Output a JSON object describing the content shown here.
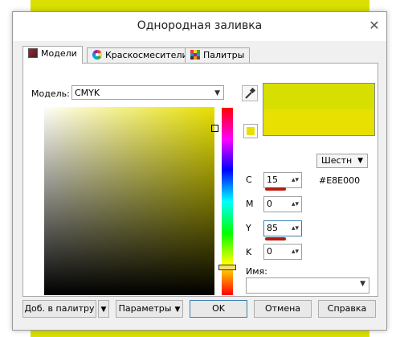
{
  "window": {
    "title": "Однородная заливка",
    "close_glyph": "✕"
  },
  "tabs": [
    {
      "label": "Модели",
      "icon": "models-icon"
    },
    {
      "label": "Краскосмесители",
      "icon": "color-wheel-icon"
    },
    {
      "label": "Палитры",
      "icon": "palette-grid-icon"
    }
  ],
  "model": {
    "label": "Модель:",
    "value": "CMYK"
  },
  "format": {
    "value": "Шестн"
  },
  "hex_value": "#E8E000",
  "channels": [
    {
      "label": "C",
      "value": "15"
    },
    {
      "label": "M",
      "value": "0"
    },
    {
      "label": "Y",
      "value": "85"
    },
    {
      "label": "K",
      "value": "0"
    }
  ],
  "name_label": "Имя:",
  "buttons": {
    "add_to_palette": "Доб. в палитру",
    "params": "Параметры",
    "ok": "OK",
    "cancel": "Отмена",
    "help": "Справка"
  },
  "colors": {
    "current": "#e8e000",
    "old": "#d7df00",
    "accent_bar": "#b31d10",
    "desktop": "#d9df00"
  }
}
